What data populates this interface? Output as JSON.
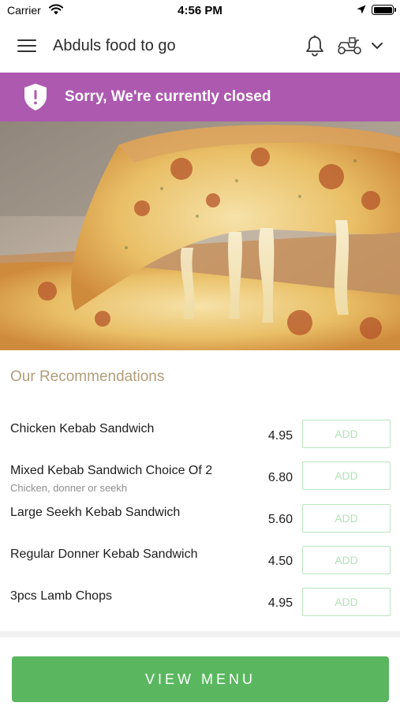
{
  "status_bar": {
    "carrier": "Carrier",
    "time": "4:56 PM"
  },
  "header": {
    "store_name": "Abduls food to go"
  },
  "banner": {
    "message": "Sorry, We're currently closed",
    "color": "#ad59b0"
  },
  "hero": {
    "image": "cheese-pizza-slice"
  },
  "recommendations": {
    "title": "Our Recommendations",
    "items": [
      {
        "name": "Chicken Kebab Sandwich",
        "description": "",
        "price": "4.95",
        "button": "ADD"
      },
      {
        "name": "Mixed Kebab Sandwich Choice Of 2",
        "description": "Chicken, donner or seekh",
        "price": "6.80",
        "button": "ADD"
      },
      {
        "name": "Large Seekh Kebab Sandwich",
        "description": "",
        "price": "5.60",
        "button": "ADD"
      },
      {
        "name": "Regular Donner Kebab Sandwich",
        "description": "",
        "price": "4.50",
        "button": "ADD"
      },
      {
        "name": "3pcs Lamb Chops",
        "description": "",
        "price": "4.95",
        "button": "ADD"
      }
    ]
  },
  "footer": {
    "view_menu_label": "VIEW MENU",
    "accent": "#5ab760"
  }
}
